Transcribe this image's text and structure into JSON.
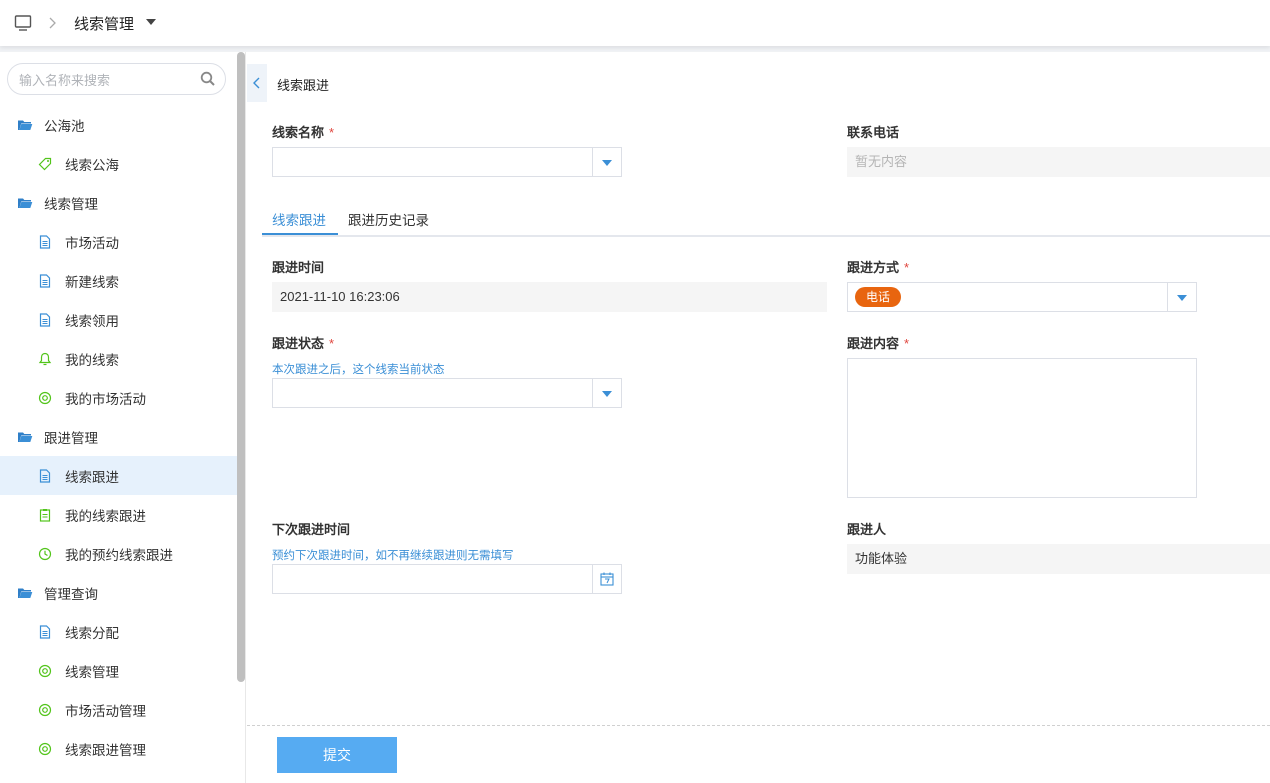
{
  "header": {
    "title": "线索管理",
    "icons": {
      "home": "monitor-icon",
      "separator": "chevron-right-icon",
      "dropdown": "caret-down-icon"
    }
  },
  "sidebar": {
    "search_placeholder": "输入名称来搜索",
    "items": [
      {
        "type": "group",
        "label": "公海池",
        "icon": "folder-open-icon"
      },
      {
        "type": "child",
        "label": "线索公海",
        "icon": "tag-icon"
      },
      {
        "type": "group",
        "label": "线索管理",
        "icon": "folder-open-icon"
      },
      {
        "type": "child",
        "label": "市场活动",
        "icon": "document-icon"
      },
      {
        "type": "child",
        "label": "新建线索",
        "icon": "document-icon"
      },
      {
        "type": "child",
        "label": "线索领用",
        "icon": "document-icon"
      },
      {
        "type": "child",
        "label": "我的线索",
        "icon": "bell-icon"
      },
      {
        "type": "child",
        "label": "我的市场活动",
        "icon": "target-icon"
      },
      {
        "type": "group",
        "label": "跟进管理",
        "icon": "folder-open-icon"
      },
      {
        "type": "child",
        "label": "线索跟进",
        "icon": "document-icon",
        "active": true
      },
      {
        "type": "child",
        "label": "我的线索跟进",
        "icon": "clipboard-icon"
      },
      {
        "type": "child",
        "label": "我的预约线索跟进",
        "icon": "clock-icon"
      },
      {
        "type": "group",
        "label": "管理查询",
        "icon": "folder-open-icon"
      },
      {
        "type": "child",
        "label": "线索分配",
        "icon": "document-icon"
      },
      {
        "type": "child",
        "label": "线索管理",
        "icon": "target-icon"
      },
      {
        "type": "child",
        "label": "市场活动管理",
        "icon": "target-icon"
      },
      {
        "type": "child",
        "label": "线索跟进管理",
        "icon": "target-icon"
      }
    ]
  },
  "main": {
    "page_title": "线索跟进",
    "lead_name": {
      "label": "线索名称",
      "required": "*",
      "value": ""
    },
    "phone": {
      "label": "联系电话",
      "placeholder": "暂无内容"
    },
    "tabs": [
      {
        "label": "线索跟进",
        "active": true
      },
      {
        "label": "跟进历史记录",
        "active": false
      }
    ],
    "follow_time": {
      "label": "跟进时间",
      "value": "2021-11-10 16:23:06"
    },
    "follow_method": {
      "label": "跟进方式",
      "required": "*",
      "value": "电话",
      "tag_color": "#e8650f"
    },
    "follow_status": {
      "label": "跟进状态",
      "required": "*",
      "hint": "本次跟进之后，这个线索当前状态",
      "value": ""
    },
    "follow_content": {
      "label": "跟进内容",
      "required": "*",
      "value": ""
    },
    "next_time": {
      "label": "下次跟进时间",
      "hint": "预约下次跟进时间，如不再继续跟进则无需填写",
      "value": ""
    },
    "follower": {
      "label": "跟进人",
      "value": "功能体验"
    },
    "submit_label": "提交"
  },
  "colors": {
    "accent": "#3b8fd6",
    "submit": "#56abf2",
    "required": "#e0453d",
    "active_bg": "#e6f1fc"
  }
}
